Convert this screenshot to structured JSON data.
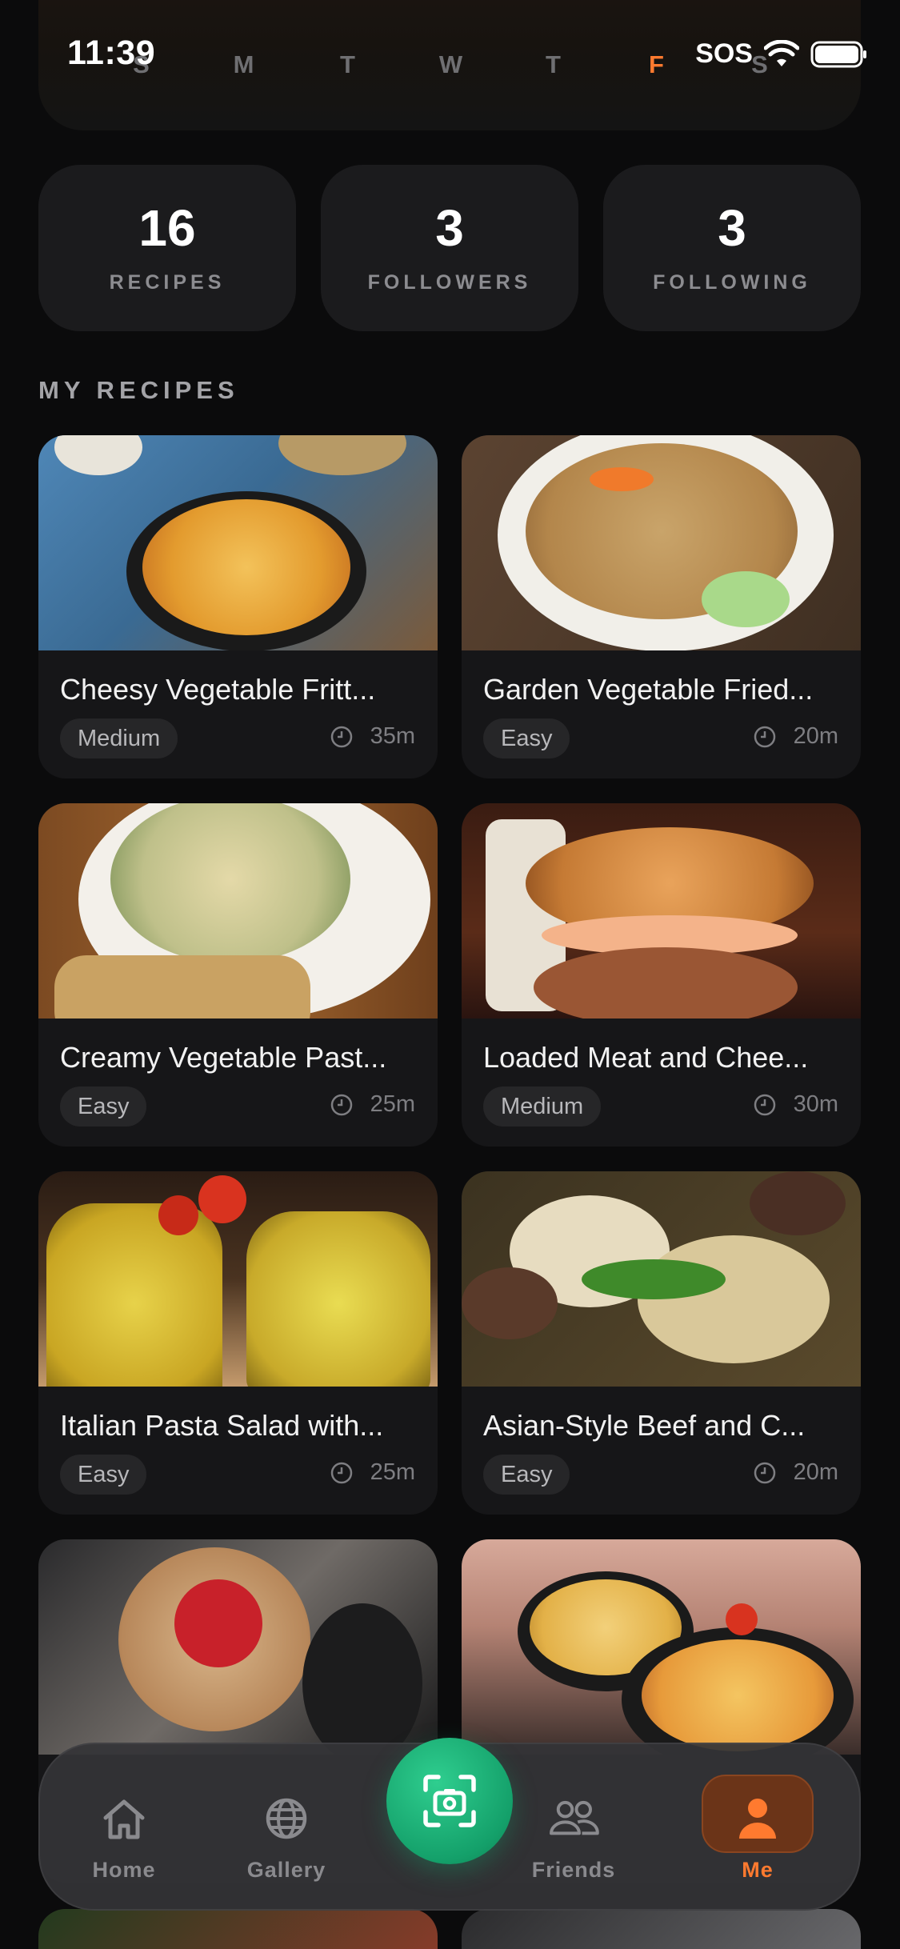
{
  "status_bar": {
    "time": "11:39",
    "sos": "SOS"
  },
  "week": {
    "days": [
      {
        "letter": "S",
        "state": "done"
      },
      {
        "letter": "M",
        "state": "done"
      },
      {
        "letter": "T",
        "state": "done"
      },
      {
        "letter": "W",
        "state": "done"
      },
      {
        "letter": "T",
        "state": "done"
      },
      {
        "letter": "F",
        "state": "today"
      },
      {
        "letter": "S",
        "state": "future"
      }
    ]
  },
  "stats": [
    {
      "value": "16",
      "label": "RECIPES"
    },
    {
      "value": "3",
      "label": "FOLLOWERS"
    },
    {
      "value": "3",
      "label": "FOLLOWING"
    }
  ],
  "section_title": "MY RECIPES",
  "recipes": [
    {
      "title": "Cheesy Vegetable Fritt...",
      "difficulty": "Medium",
      "time": "35m"
    },
    {
      "title": "Garden Vegetable Fried...",
      "difficulty": "Easy",
      "time": "20m"
    },
    {
      "title": "Creamy Vegetable Past...",
      "difficulty": "Easy",
      "time": "25m"
    },
    {
      "title": "Loaded Meat and Chee...",
      "difficulty": "Medium",
      "time": "30m"
    },
    {
      "title": "Italian Pasta Salad with...",
      "difficulty": "Easy",
      "time": "25m"
    },
    {
      "title": "Asian-Style Beef and C...",
      "difficulty": "Easy",
      "time": "20m"
    }
  ],
  "nav": {
    "home": "Home",
    "gallery": "Gallery",
    "friends": "Friends",
    "me": "Me"
  },
  "colors": {
    "accent": "#ff7a2f",
    "scan_button": "#1db27a",
    "card_bg": "#161618",
    "page_bg": "#0b0b0c"
  }
}
